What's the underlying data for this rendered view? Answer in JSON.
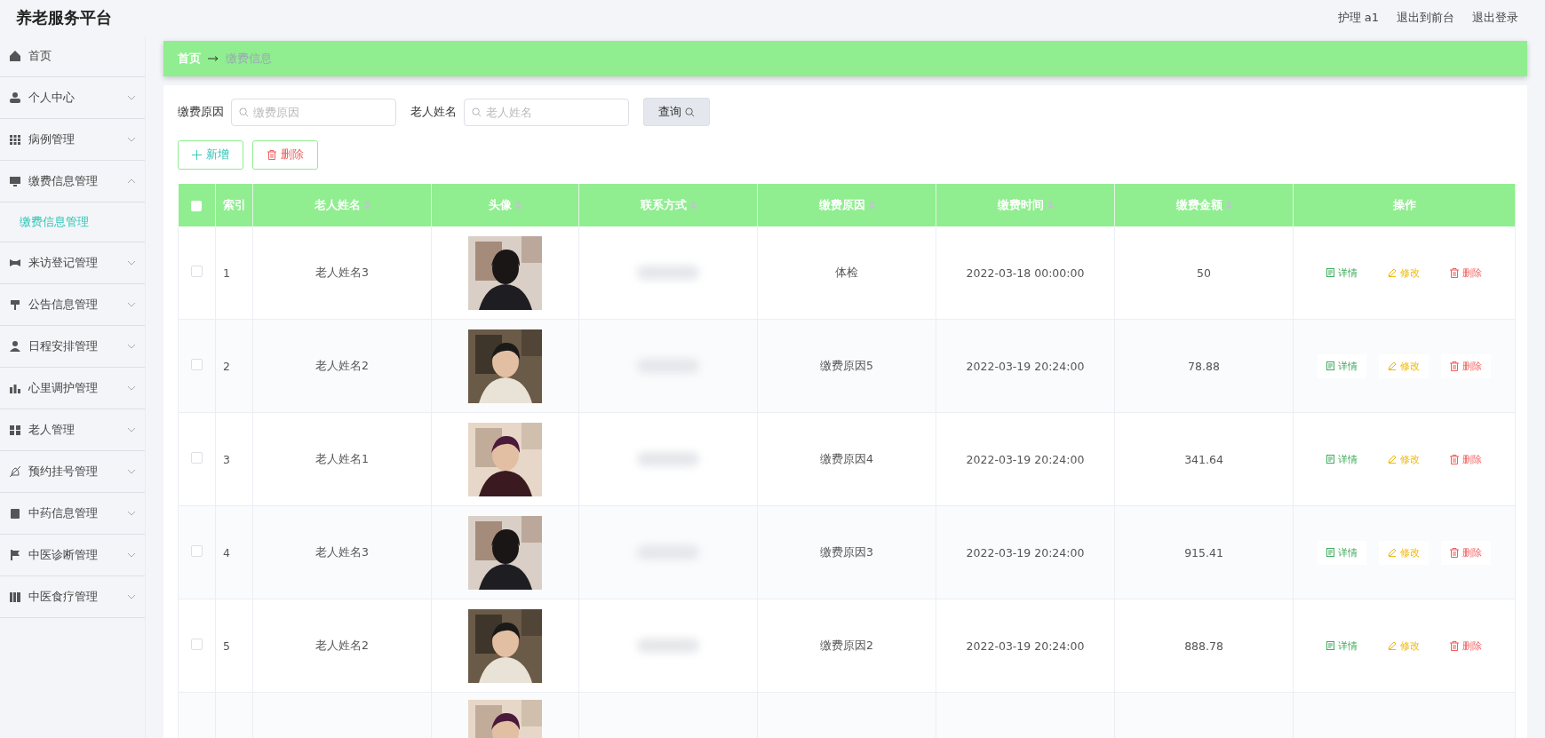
{
  "header": {
    "title": "养老服务平台",
    "links": [
      {
        "label": "护理 a1"
      },
      {
        "label": "退出到前台"
      },
      {
        "label": "退出登录"
      }
    ]
  },
  "sidebar": {
    "items": [
      {
        "label": "首页"
      },
      {
        "label": "个人中心",
        "expanded": false
      },
      {
        "label": "病例管理",
        "expanded": false
      },
      {
        "label": "缴费信息管理",
        "expanded": true,
        "children": [
          {
            "label": "缴费信息管理",
            "selected": true
          }
        ]
      },
      {
        "label": "来访登记管理",
        "expanded": false
      },
      {
        "label": "公告信息管理",
        "expanded": false
      },
      {
        "label": "日程安排管理",
        "expanded": false
      },
      {
        "label": "心里调护管理",
        "expanded": false
      },
      {
        "label": "老人管理",
        "expanded": false
      },
      {
        "label": "预约挂号管理",
        "expanded": false
      },
      {
        "label": "中药信息管理",
        "expanded": false
      },
      {
        "label": "中医诊断管理",
        "expanded": false
      },
      {
        "label": "中医食疗管理",
        "expanded": false
      }
    ]
  },
  "breadcrumb": [
    {
      "label": "首页"
    },
    {
      "label": "缴费信息"
    }
  ],
  "search": {
    "fields": [
      {
        "label": "缴费原因",
        "placeholder": "缴费原因"
      },
      {
        "label": "老人姓名",
        "placeholder": "老人姓名"
      }
    ],
    "button": "查询"
  },
  "actions": [
    {
      "kind": "add",
      "label": "新增"
    },
    {
      "kind": "delete",
      "label": "删除"
    }
  ],
  "table": {
    "columns": [
      {
        "kind": "check",
        "checked": false
      },
      {
        "label": "索引",
        "sortable": false
      },
      {
        "label": "老人姓名",
        "sortable": true
      },
      {
        "label": "头像",
        "sortable": true
      },
      {
        "label": "联系方式",
        "sortable": true
      },
      {
        "label": "缴费原因",
        "sortable": true
      },
      {
        "label": "缴费时间",
        "sortable": true
      },
      {
        "label": "缴费金额",
        "sortable": true
      },
      {
        "label": "操作",
        "sortable": false
      }
    ],
    "rows": [
      {
        "checked": false,
        "index": "1",
        "name": "老人姓名3",
        "avatar": {
          "kind": "picture"
        },
        "contact_blurred": true,
        "reason": "体检",
        "time": "2022-03-18 00:00:00",
        "amount": "50",
        "actions": [
          {
            "kind": "detail",
            "label": "详情"
          },
          {
            "kind": "edit",
            "label": "修改"
          },
          {
            "kind": "delete",
            "label": "删除"
          }
        ]
      },
      {
        "checked": false,
        "index": "2",
        "name": "老人姓名2",
        "avatar": {
          "kind": "picture"
        },
        "contact_blurred": true,
        "reason": "缴费原因5",
        "time": "2022-03-19 20:24:00",
        "amount": "78.88",
        "actions": [
          {
            "kind": "detail",
            "label": "详情"
          },
          {
            "kind": "edit",
            "label": "修改"
          },
          {
            "kind": "delete",
            "label": "删除"
          }
        ]
      },
      {
        "checked": false,
        "index": "3",
        "name": "老人姓名1",
        "avatar": {
          "kind": "picture"
        },
        "contact_blurred": true,
        "reason": "缴费原因4",
        "time": "2022-03-19 20:24:00",
        "amount": "341.64",
        "actions": [
          {
            "kind": "detail",
            "label": "详情"
          },
          {
            "kind": "edit",
            "label": "修改"
          },
          {
            "kind": "delete",
            "label": "删除"
          }
        ]
      },
      {
        "checked": false,
        "index": "4",
        "name": "老人姓名3",
        "avatar": {
          "kind": "picture"
        },
        "contact_blurred": true,
        "reason": "缴费原因3",
        "time": "2022-03-19 20:24:00",
        "amount": "915.41",
        "actions": [
          {
            "kind": "detail",
            "label": "详情"
          },
          {
            "kind": "edit",
            "label": "修改"
          },
          {
            "kind": "delete",
            "label": "删除"
          }
        ]
      },
      {
        "checked": false,
        "index": "5",
        "name": "老人姓名2",
        "avatar": {
          "kind": "picture"
        },
        "contact_blurred": true,
        "reason": "缴费原因2",
        "time": "2022-03-19 20:24:00",
        "amount": "888.78",
        "actions": [
          {
            "kind": "detail",
            "label": "详情"
          },
          {
            "kind": "edit",
            "label": "修改"
          },
          {
            "kind": "delete",
            "label": "删除"
          }
        ]
      },
      {
        "avatar": {
          "kind": "picture"
        }
      }
    ]
  }
}
